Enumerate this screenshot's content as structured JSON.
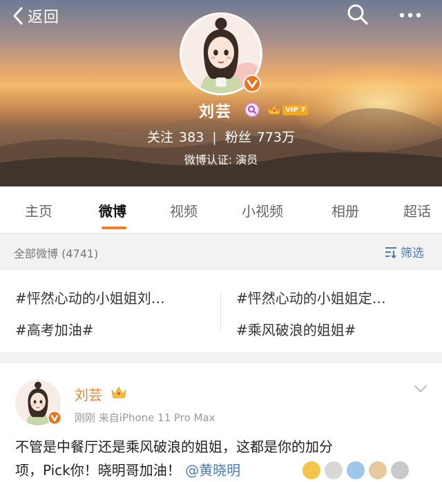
{
  "header": {
    "back_label": "返回",
    "name": "刘芸",
    "vip_level": "VIP 7",
    "stats": {
      "follow_label": "关注",
      "follow_count": "383",
      "fans_label": "粉丝",
      "fans_count": "773万"
    },
    "verification": "微博认证: 演员",
    "icons": [
      "back-chevron-icon",
      "search-icon",
      "more-icon",
      "verified-icon",
      "super-topic-icon",
      "crown-icon"
    ]
  },
  "tabs": [
    {
      "label": "主页",
      "active": false
    },
    {
      "label": "微博",
      "active": true
    },
    {
      "label": "视频",
      "active": false
    },
    {
      "label": "小视频",
      "active": false
    },
    {
      "label": "相册",
      "active": false
    },
    {
      "label": "超话",
      "active": false
    }
  ],
  "filter": {
    "count_label": "全部微博 (4741)",
    "filter_label": "筛选"
  },
  "topics": [
    "#怦然心动的小姐姐刘…",
    "#怦然心动的小姐姐定…",
    "#高考加油#",
    "#乘风破浪的姐姐#"
  ],
  "post": {
    "author": "刘芸",
    "meta": "刚刚  来自iPhone 11 Pro Max",
    "text_line1": "不管是中餐厅还是乘风破浪的姐姐，这都是你的加分",
    "text_line2": "项，Pick你！晓明哥加油！",
    "mention": "@黄晓明"
  },
  "colors": {
    "accent": "#f77b24",
    "link": "#4a7bb5",
    "author": "#e8862a",
    "vip": "#f5a623"
  }
}
